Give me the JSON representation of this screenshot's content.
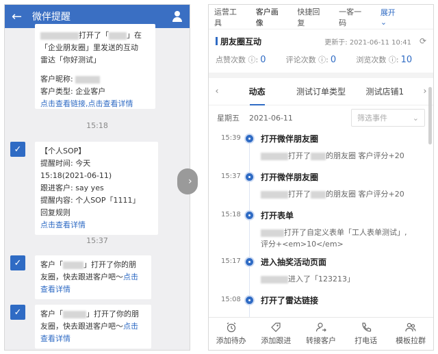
{
  "left": {
    "header_title": "微伴提醒",
    "messages": [
      {
        "line1_tail": "打开了「",
        "line1_end": "」在",
        "line2": "「企业朋友圈」里发送的互动",
        "line3": "雷达「你好测试」",
        "nick_label": "客户昵称:",
        "type_line": "客户类型: 企业客户",
        "link1": "点击查看链接",
        "link_sep": ",",
        "link2": "点击查看详情"
      }
    ],
    "time1": "15:18",
    "sop": {
      "title": "【个人SOP】",
      "time_line1": "提醒时间: 今天",
      "time_line2": "15:18(2021-06-11)",
      "follow_line": "跟进客户: say  yes",
      "content_line": "提醒内容: 个人SOP「1111」",
      "content_line2": "回复规则",
      "link": "点击查看详情"
    },
    "time2": "15:37",
    "notify": [
      {
        "prefix": "客户「",
        "mid": "」打开了你的朋",
        "line2": "友圈，快去跟进客户吧～",
        "link_a": "点击",
        "link_b": "查看详情"
      },
      {
        "prefix": "客户「",
        "mid": "」打开了你的朋",
        "line2": "友圈，快去跟进客户吧～",
        "link_a": "点击",
        "link_b": "查看详情"
      }
    ]
  },
  "right": {
    "top_tabs": [
      "运营工具",
      "客户画像",
      "快捷回复",
      "一客一码"
    ],
    "expand_label": "展开",
    "section_title": "朋友圈互动",
    "updated": "更新于: 2021-06-11 10:41",
    "stats": [
      {
        "label": "点赞次数",
        "value": "0"
      },
      {
        "label": "评论次数",
        "value": "0"
      },
      {
        "label": "浏览次数",
        "value": "10"
      }
    ],
    "tabs": [
      "动态",
      "测试订单类型",
      "测试店铺1"
    ],
    "weekday": "星期五",
    "date": "2021-06-11",
    "filter_placeholder": "筛选事件",
    "events": [
      {
        "time": "15:39",
        "title": "打开微伴朋友圈",
        "desc": "打开了",
        "desc2": "的朋友圈 客户评分+20"
      },
      {
        "time": "15:37",
        "title": "打开微伴朋友圈",
        "desc": "打开了",
        "desc2": "的朋友圈 客户评分+20"
      },
      {
        "time": "15:18",
        "title": "打开表单",
        "desc": "打开了自定义表单「工人表单测试」,",
        "desc2": "评分+<em>10</em>"
      },
      {
        "time": "15:17",
        "title": "进入抽奖活动页面",
        "desc": "进入了「123213」",
        "desc2": ""
      },
      {
        "time": "15:08",
        "title": "打开了雷达链接",
        "desc": "",
        "desc2": ""
      }
    ],
    "bottom_buttons": [
      {
        "label": "添加待办",
        "icon": "alarm-clock-icon"
      },
      {
        "label": "添加跟进",
        "icon": "tag-icon"
      },
      {
        "label": "转接客户",
        "icon": "user-transfer-icon"
      },
      {
        "label": "打电话",
        "icon": "phone-icon"
      },
      {
        "label": "模板拉群",
        "icon": "group-icon"
      }
    ]
  }
}
